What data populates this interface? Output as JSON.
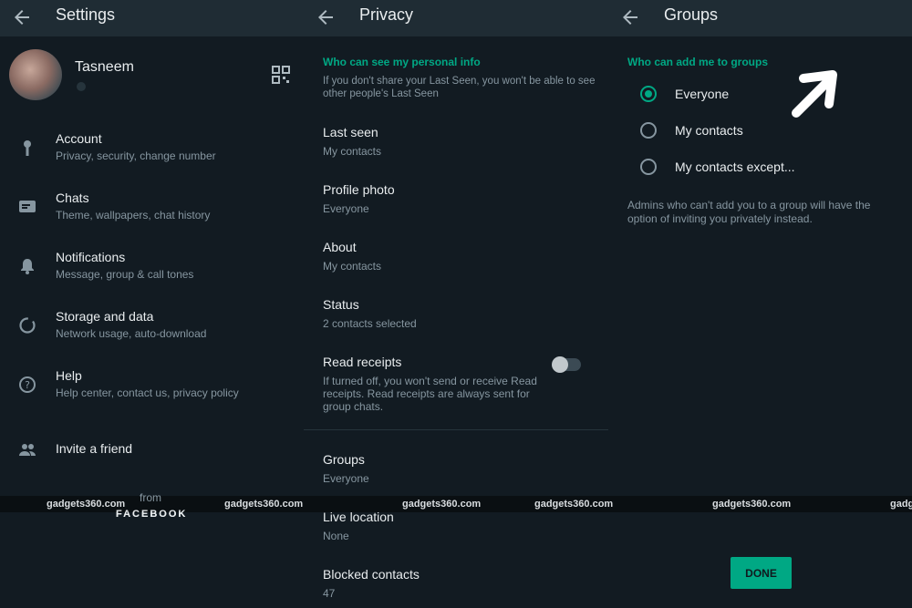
{
  "settings": {
    "title": "Settings",
    "profile_name": "Tasneem",
    "items": [
      {
        "label": "Account",
        "sub": "Privacy, security, change number",
        "icon": "key-icon"
      },
      {
        "label": "Chats",
        "sub": "Theme, wallpapers, chat history",
        "icon": "chat-icon"
      },
      {
        "label": "Notifications",
        "sub": "Message, group & call tones",
        "icon": "bell-icon"
      },
      {
        "label": "Storage and data",
        "sub": "Network usage, auto-download",
        "icon": "storage-icon"
      },
      {
        "label": "Help",
        "sub": "Help center, contact us, privacy policy",
        "icon": "help-icon"
      },
      {
        "label": "Invite a friend",
        "sub": "",
        "icon": "people-icon"
      }
    ],
    "from": "from",
    "brand": "FACEBOOK"
  },
  "privacy": {
    "title": "Privacy",
    "section": "Who can see my personal info",
    "section_note": "If you don't share your Last Seen, you won't be able to see other people's Last Seen",
    "items": [
      {
        "label": "Last seen",
        "value": "My contacts"
      },
      {
        "label": "Profile photo",
        "value": "Everyone"
      },
      {
        "label": "About",
        "value": "My contacts"
      },
      {
        "label": "Status",
        "value": "2 contacts selected"
      },
      {
        "label": "Read receipts",
        "value": "If turned off, you won't send or receive Read receipts. Read receipts are always sent for group chats."
      },
      {
        "label": "Groups",
        "value": "Everyone"
      },
      {
        "label": "Live location",
        "value": "None"
      },
      {
        "label": "Blocked contacts",
        "value": "47"
      }
    ],
    "read_receipts_on": false
  },
  "groups": {
    "title": "Groups",
    "section": "Who can add me to groups",
    "options": [
      "Everyone",
      "My contacts",
      "My contacts except..."
    ],
    "selected": "Everyone",
    "note": "Admins who can't add you to a group will have the option of inviting you privately instead.",
    "done_label": "DONE"
  },
  "watermark": "gadgets360.com",
  "colors": {
    "accent": "#00a884",
    "background": "#121b22",
    "appbar": "#1f2c34"
  }
}
